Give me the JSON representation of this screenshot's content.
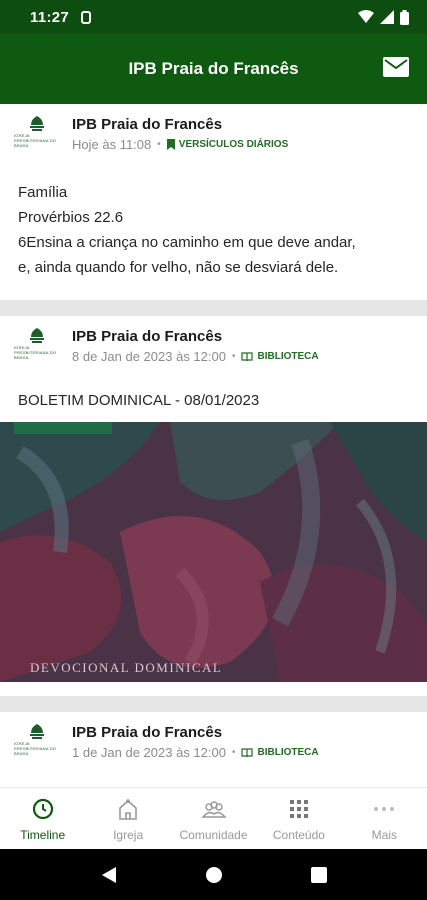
{
  "status_bar": {
    "time": "11:27"
  },
  "app_bar": {
    "title": "IPB Praia do Francês",
    "mail_icon": "mail-icon"
  },
  "colors": {
    "primary": "#0d5a10",
    "status": "#0d4d10",
    "tag": "#1f6e22",
    "inactive": "#9a9a9a"
  },
  "posts": [
    {
      "author": "IPB Praia do Francês",
      "logo_text": "IGREJA PRESBITERIANA DO BRASIL",
      "time": "Hoje às 11:08",
      "tag": "VERSÍCULOS DIÁRIOS",
      "tag_icon": "bookmark-icon",
      "body_lines": [
        "Família",
        "Provérbios 22.6",
        "6Ensina a criança no caminho em que deve andar,",
        "e, ainda quando for velho, não se desviará dele."
      ]
    },
    {
      "author": "IPB Praia do Francês",
      "logo_text": "IGREJA PRESBITERIANA DO BRASIL",
      "time": "8 de Jan de 2023 às 12:00",
      "tag": "BIBLIOTECA",
      "tag_icon": "book-icon",
      "title": "BOLETIM DOMINICAL - 08/01/2023",
      "image_caption": "DEVOCIONAL DOMINICAL"
    },
    {
      "author": "IPB Praia do Francês",
      "logo_text": "IGREJA PRESBITERIANA DO BRASIL",
      "time": "1 de Jan de 2023 às 12:00",
      "tag": "BIBLIOTECA",
      "tag_icon": "book-icon"
    }
  ],
  "bottom_nav": [
    {
      "label": "Timeline",
      "icon": "clock-icon",
      "active": true
    },
    {
      "label": "Igreja",
      "icon": "church-icon",
      "active": false
    },
    {
      "label": "Comunidade",
      "icon": "community-icon",
      "active": false
    },
    {
      "label": "Conteúdo",
      "icon": "grid-icon",
      "active": false
    },
    {
      "label": "Mais",
      "icon": "more-icon",
      "active": false
    }
  ]
}
